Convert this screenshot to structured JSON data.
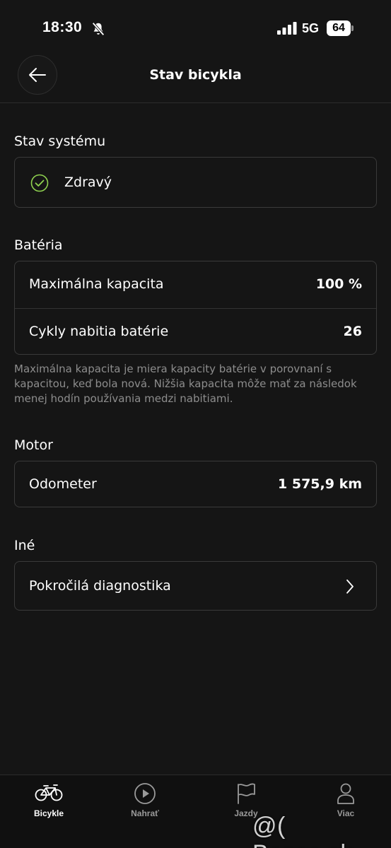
{
  "status_bar": {
    "time": "18:30",
    "network": "5G",
    "battery": "64"
  },
  "header": {
    "title": "Stav bicykla"
  },
  "system": {
    "title": "Stav systému",
    "status": "Zdravý",
    "status_color": "#8fd14f"
  },
  "battery": {
    "title": "Batéria",
    "rows": [
      {
        "label": "Maximálna kapacita",
        "value": "100 %"
      },
      {
        "label": "Cykly nabitia batérie",
        "value": "26"
      }
    ],
    "note": "Maximálna kapacita je miera kapacity batérie v porovnaní s kapacitou, keď bola nová. Nižšia kapacita môže mať za následok menej hodín používania medzi nabitiami."
  },
  "motor": {
    "title": "Motor",
    "rows": [
      {
        "label": "Odometer",
        "value": "1 575,9 km"
      }
    ]
  },
  "other": {
    "title": "Iné",
    "rows": [
      {
        "label": "Pokročilá diagnostika"
      }
    ]
  },
  "bottom_nav": {
    "items": [
      {
        "label": "Bicykle",
        "icon": "bicycle-icon",
        "active": true
      },
      {
        "label": "Nahrať",
        "icon": "play-circle-icon",
        "active": false
      },
      {
        "label": "Jazdy",
        "icon": "flag-icon",
        "active": false
      },
      {
        "label": "Viac",
        "icon": "person-icon",
        "active": false
      }
    ]
  },
  "watermark": "@( Bazos.sk"
}
